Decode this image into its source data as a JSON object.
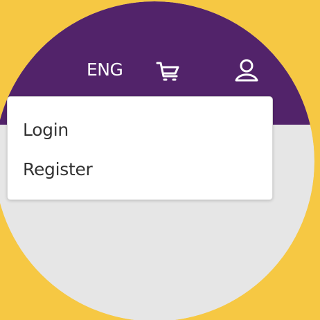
{
  "header": {
    "language": "ENG",
    "icons": {
      "cart": "shopping-cart-icon",
      "user": "user-account-icon"
    },
    "colors": {
      "header_bg": "#52236a",
      "page_bg": "#e6e6e6",
      "outer_bg": "#f6c843"
    }
  },
  "dropdown": {
    "items": [
      {
        "label": "Login"
      },
      {
        "label": "Register"
      }
    ]
  }
}
